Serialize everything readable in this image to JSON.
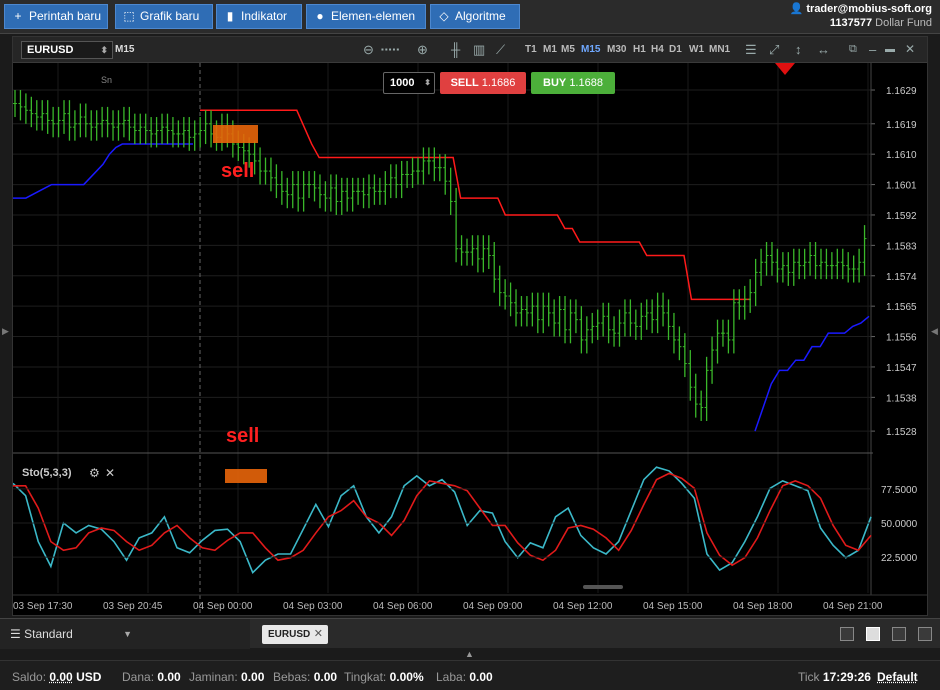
{
  "toolbar": {
    "buttons": [
      {
        "icon": "plus-icon",
        "glyph": "+",
        "label": "Perintah baru"
      },
      {
        "icon": "chart-icon",
        "glyph": "⬚",
        "label": "Grafik baru"
      },
      {
        "icon": "bars-icon",
        "glyph": "▮",
        "label": "Indikator"
      },
      {
        "icon": "shapes-icon",
        "glyph": "●",
        "label": "Elemen-elemen"
      },
      {
        "icon": "diamond-icon",
        "glyph": "◇",
        "label": "Algoritme"
      }
    ]
  },
  "account": {
    "user": "trader@mobius-soft.org",
    "id": "1137577",
    "fund": "Dollar Fund"
  },
  "chart_toolbar": {
    "symbol": "EURUSD",
    "period": "M15",
    "zoom_dots": "▪▪▪▪▪",
    "timeframes": [
      "T1",
      "M1",
      "M5",
      "M15",
      "M30",
      "H1",
      "H4",
      "D1",
      "W1",
      "MN1"
    ],
    "active_timeframe": "M15"
  },
  "order_panel": {
    "quantity": "1000",
    "sell_label": "SELL",
    "sell_price": "1.1686",
    "buy_label": "BUY",
    "buy_price": "1.1688"
  },
  "annotations": {
    "sell_main": "sell",
    "sell_lower": "sell",
    "session_label": "Sn"
  },
  "indicator": {
    "label": "Sto(5,3,3)"
  },
  "colors": {
    "bar": "#3ab82a",
    "stop": "#ff1a1a",
    "support": "#1a1aff",
    "stoch_k": "#3bb8c8",
    "stoch_d": "#e01a1a",
    "sell_btn": "#e04040",
    "buy_btn": "#4caf3a",
    "marker": "#e8650a"
  },
  "chart_data": [
    {
      "type": "line",
      "symbol": "EURUSD",
      "timeframe": "M15",
      "y_ticks": [
        "1.1629",
        "1.1619",
        "1.1610",
        "1.1601",
        "1.1592",
        "1.1583",
        "1.1574",
        "1.1565",
        "1.1556",
        "1.1547",
        "1.1538",
        "1.1528"
      ],
      "ylim": [
        1.1523,
        1.1637
      ],
      "x_ticks": [
        "03 Sep 17:30",
        "03 Sep 20:45",
        "04 Sep 00:00",
        "04 Sep 03:00",
        "04 Sep 06:00",
        "04 Sep 09:00",
        "04 Sep 12:00",
        "04 Sep 15:00",
        "04 Sep 18:00",
        "04 Sep 21:00"
      ],
      "series": [
        {
          "style": "ohlc-bars",
          "values": [
            1.1625,
            1.1624,
            1.1623,
            1.1622,
            1.1621,
            1.1622,
            1.162,
            1.1619,
            1.162,
            1.1622,
            1.1618,
            1.1619,
            1.1621,
            1.1619,
            1.1618,
            1.1619,
            1.162,
            1.1619,
            1.1618,
            1.1619,
            1.162,
            1.1618,
            1.1617,
            1.1618,
            1.1617,
            1.1616,
            1.1617,
            1.1618,
            1.1617,
            1.1616,
            1.1616,
            1.1617,
            1.1615,
            1.1616,
            1.1617,
            1.1619,
            1.1616,
            1.1615,
            1.1618,
            1.1616,
            1.1613,
            1.1612,
            1.1611,
            1.161,
            1.1608,
            1.1605,
            1.1605,
            1.1603,
            1.1601,
            1.1599,
            1.1598,
            1.1601,
            1.1597,
            1.1601,
            1.1601,
            1.16,
            1.1598,
            1.1597,
            1.16,
            1.1596,
            1.1599,
            1.1597,
            1.1599,
            1.1599,
            1.1598,
            1.16,
            1.1599,
            1.1599,
            1.1601,
            1.1603,
            1.1601,
            1.1604,
            1.1604,
            1.1605,
            1.1605,
            1.1608,
            1.1608,
            1.1606,
            1.1606,
            1.1602,
            1.1596,
            1.1582,
            1.1581,
            1.1581,
            1.1582,
            1.1579,
            1.1582,
            1.158,
            1.1573,
            1.1569,
            1.1568,
            1.1566,
            1.1563,
            1.1564,
            1.1563,
            1.1565,
            1.1561,
            1.1565,
            1.1563,
            1.156,
            1.1564,
            1.1558,
            1.1563,
            1.1561,
            1.1555,
            1.1558,
            1.1559,
            1.156,
            1.1562,
            1.1558,
            1.1557,
            1.156,
            1.1563,
            1.156,
            1.1559,
            1.1562,
            1.1563,
            1.1561,
            1.1565,
            1.1563,
            1.1559,
            1.1555,
            1.1553,
            1.1548,
            1.1541,
            1.1536,
            1.1535,
            1.1546,
            1.1552,
            1.1557,
            1.1557,
            1.1555,
            1.1566,
            1.1565,
            1.1567,
            1.1569,
            1.1575,
            1.1578,
            1.158,
            1.1578,
            1.1576,
            1.1577,
            1.1575,
            1.1578,
            1.1577,
            1.1578,
            1.158,
            1.1577,
            1.1578,
            1.1577,
            1.1577,
            1.1578,
            1.1577,
            1.1576,
            1.1576,
            1.1578,
            1.1585
          ]
        },
        {
          "style": "stop-line",
          "values": [
            1.1623,
            1.1623,
            1.1623,
            1.1623,
            1.1623,
            1.1623,
            1.1623,
            1.1623,
            1.1623,
            1.1623,
            1.1623,
            1.1623,
            1.1623,
            1.1623,
            1.1618,
            1.1613,
            1.1609,
            1.1609,
            1.1609,
            1.1609,
            1.1609,
            1.1609,
            1.1609,
            1.1609,
            1.1609,
            1.1609,
            1.1609,
            1.1609,
            1.1609,
            1.1609,
            1.1609,
            1.1609,
            1.1609,
            1.1609,
            1.1609,
            1.1597,
            1.1597,
            1.1597,
            1.1597,
            1.1597,
            1.1597,
            1.1592,
            1.1592,
            1.1592,
            1.1592,
            1.1592,
            1.1592,
            1.1592,
            1.1592,
            1.1588,
            1.1588,
            1.1584,
            1.1584,
            1.1584,
            1.1584,
            1.1584,
            1.1584,
            1.1584,
            1.1584,
            1.1584,
            1.158,
            1.158,
            1.158,
            1.158,
            1.158,
            1.158,
            1.1567,
            1.1567,
            1.1567,
            1.1567,
            1.1567,
            1.1567,
            1.1567,
            1.1567,
            1.1567
          ]
        },
        {
          "style": "support-line",
          "values": [
            1.1597,
            1.1597,
            1.1597,
            1.1598,
            1.1599,
            1.16,
            1.1601,
            1.1601,
            1.1601,
            1.1601,
            1.1601,
            1.1601,
            1.1603,
            1.1605,
            1.1607,
            1.161,
            1.1612,
            1.1613,
            1.1613,
            1.1613,
            1.1613,
            1.1613,
            1.1613,
            1.1613,
            1.1613,
            1.1613,
            1.1613,
            1.1613,
            1.1613
          ]
        },
        {
          "style": "support-line",
          "values": [
            1.1528,
            1.1535,
            1.1542,
            1.1546,
            1.1546,
            1.1549,
            1.1549,
            1.1553,
            1.1553,
            1.1557,
            1.1557,
            1.1557,
            1.1559,
            1.156,
            1.1562
          ]
        }
      ]
    },
    {
      "type": "line",
      "title": "Sto(5,3,3)",
      "y_ticks": [
        "77.5000",
        "50.0000",
        "22.5000"
      ],
      "ylim": [
        0,
        100
      ],
      "series": [
        {
          "style": "k-line",
          "values": [
            82,
            72,
            35,
            15,
            50,
            42,
            48,
            45,
            35,
            20,
            38,
            42,
            55,
            30,
            26,
            36,
            44,
            45,
            35,
            10,
            20,
            25,
            25,
            45,
            65,
            47,
            72,
            80,
            55,
            42,
            55,
            80,
            88,
            80,
            85,
            75,
            48,
            60,
            58,
            35,
            22,
            34,
            30,
            55,
            62,
            40,
            30,
            25,
            35,
            60,
            85,
            95,
            92,
            82,
            70,
            25,
            12,
            18,
            35,
            55,
            78,
            84,
            80,
            76,
            46,
            32,
            22,
            28,
            55
          ]
        },
        {
          "style": "d-line",
          "values": [
            80,
            80,
            62,
            35,
            28,
            30,
            42,
            46,
            44,
            35,
            28,
            32,
            42,
            48,
            38,
            30,
            28,
            36,
            42,
            42,
            30,
            20,
            22,
            28,
            42,
            55,
            60,
            68,
            55,
            50,
            40,
            52,
            72,
            84,
            82,
            80,
            76,
            62,
            48,
            48,
            34,
            24,
            20,
            28,
            46,
            48,
            45,
            38,
            28,
            44,
            65,
            85,
            90,
            86,
            78,
            42,
            24,
            16,
            22,
            38,
            60,
            80,
            84,
            80,
            70,
            48,
            32,
            28,
            40
          ]
        }
      ]
    }
  ],
  "bottom": {
    "layout_label": "Standard",
    "tab_symbol": "EURUSD",
    "status": [
      {
        "label": "Saldo:",
        "value": "0.00",
        "unit": "USD"
      },
      {
        "label": "Dana:",
        "value": "0.00"
      },
      {
        "label": "Jaminan:",
        "value": "0.00"
      },
      {
        "label": "Bebas:",
        "value": "0.00"
      },
      {
        "label": "Tingkat:",
        "value": "0.00%"
      },
      {
        "label": "Laba:",
        "value": "0.00"
      }
    ],
    "tick_label": "Tick",
    "tick_time": "17:29:26",
    "profile": "Default"
  }
}
